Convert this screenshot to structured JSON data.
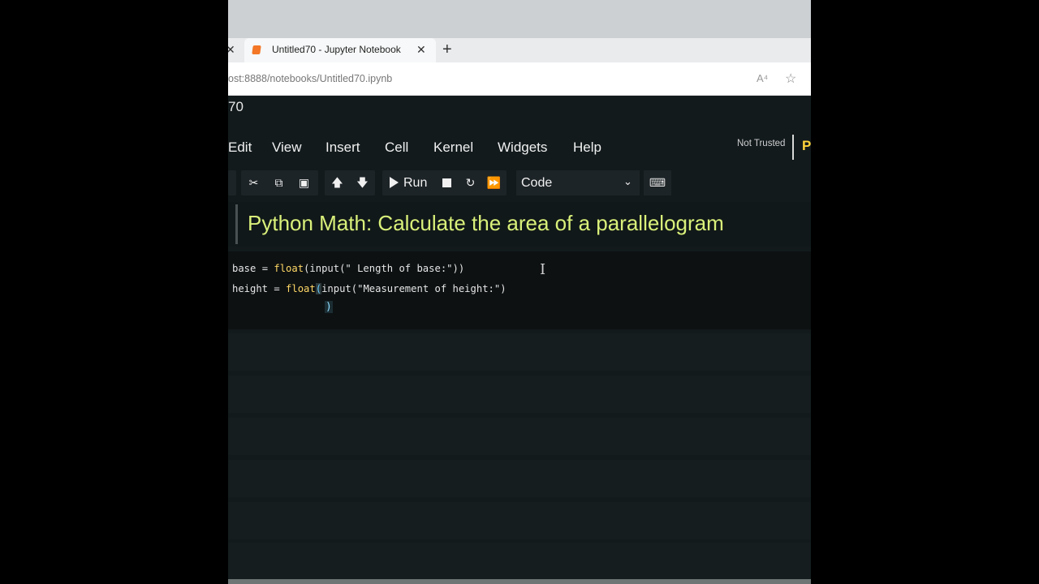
{
  "browser": {
    "tab_title": "Untitled70 - Jupyter Notebook",
    "tab_close_glyph": "✕",
    "new_tab_glyph": "+",
    "url": "ost:8888/notebooks/Untitled70.ipynb",
    "read_aloud_glyph": "A⁴",
    "favorite_glyph": "☆"
  },
  "notebook": {
    "name": "70",
    "menu": [
      "Edit",
      "View",
      "Insert",
      "Cell",
      "Kernel",
      "Widgets",
      "Help"
    ],
    "trust_status": "Not Trusted",
    "kernel_logo": "P"
  },
  "toolbar": {
    "run_label": "Run",
    "cell_type": "Code"
  },
  "cells": {
    "markdown_heading": "Python Math: Calculate the area of a parallelogram",
    "code": {
      "line1": {
        "var": "base",
        "op": " = ",
        "fn": "float",
        "rest": "(input(\" Length of base:\"))"
      },
      "line2": {
        "var": "height",
        "op": " = ",
        "fn": "float",
        "open": "(",
        "rest": "input(\"Measurement of height:\")"
      },
      "line3": ")"
    }
  },
  "colors": {
    "heading": "#d9f07a",
    "background": "#121a1c",
    "kernel_logo": "#ffd43b"
  }
}
